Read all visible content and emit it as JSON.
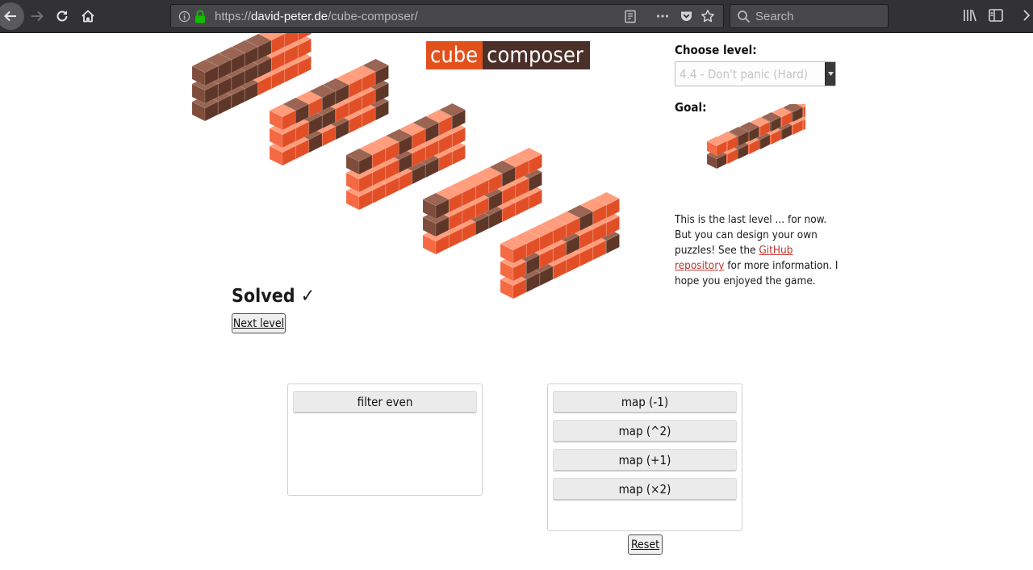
{
  "browser": {
    "url_prefix": "https://",
    "url_host": "david-peter.de",
    "url_path": "/cube-composer/",
    "search_placeholder": "Search",
    "colors": {
      "toolbar": "#323234",
      "field": "#474749",
      "secure_lock": "#12bc00"
    },
    "icons": [
      "back-arrow-icon",
      "forward-arrow-icon",
      "reload-icon",
      "home-icon",
      "info-icon",
      "lock-icon",
      "reader-view-icon",
      "more-actions-icon",
      "pocket-icon",
      "bookmark-star-icon",
      "search-icon",
      "library-icon",
      "sidebar-icon",
      "overflow-icon"
    ]
  },
  "logo": {
    "part1": "cube",
    "part2": "composer"
  },
  "colors": {
    "orange": "#e2511c",
    "brown": "#4a3029",
    "link": "#c0332e"
  },
  "status": {
    "solved_label": "Solved ✓",
    "next_level_label": "Next level"
  },
  "sidebar": {
    "choose_level_label": "Choose level:",
    "level_selected": "4.4 - Don't panic (Hard)",
    "goal_label": "Goal:",
    "info_before_link": "This is the last level ... for now. But you can design your own puzzles! See the ",
    "link_label": "GitHub repository",
    "info_after_link": " for more information. I hope you enjoyed the game."
  },
  "available_functions": [
    "filter even"
  ],
  "program_functions": [
    "map (-1)",
    "map (^2)",
    "map (+1)",
    "map (×2)"
  ],
  "reset_label": "Reset",
  "scene": {
    "walls": [
      [
        [
          "B",
          "B",
          "B"
        ],
        [
          "B",
          "B",
          "B"
        ],
        [
          "B",
          "B",
          "B"
        ],
        [
          "B",
          "B",
          "B"
        ],
        [
          "O",
          "B",
          "B"
        ],
        [
          "O",
          "O",
          "O"
        ],
        [
          "O",
          "O",
          "O"
        ],
        [
          "O",
          "O",
          "O"
        ]
      ],
      [
        [
          "O",
          "O",
          "O"
        ],
        [
          "O",
          "O",
          "B"
        ],
        [
          "B",
          "B",
          "O"
        ],
        [
          "O",
          "B",
          "B"
        ],
        [
          "B",
          "O",
          "B"
        ],
        [
          "O",
          "O",
          "O"
        ],
        [
          "O",
          "O",
          "O"
        ],
        [
          "B",
          "B",
          "B"
        ]
      ],
      [
        [
          "O",
          "O",
          "B"
        ],
        [
          "O",
          "O",
          "O"
        ],
        [
          "O",
          "O",
          "O"
        ],
        [
          "O",
          "B",
          "B"
        ],
        [
          "B",
          "O",
          "O"
        ],
        [
          "B",
          "O",
          "B"
        ],
        [
          "O",
          "O",
          "O"
        ],
        [
          "O",
          "O",
          "B"
        ]
      ],
      [
        [
          "O",
          "B",
          "B"
        ],
        [
          "O",
          "O",
          "O"
        ],
        [
          "O",
          "O",
          "O"
        ],
        [
          "B",
          "O",
          "O"
        ],
        [
          "B",
          "B",
          "O"
        ],
        [
          "O",
          "O",
          "B"
        ],
        [
          "O",
          "O",
          "O"
        ],
        [
          "O",
          "B",
          "O"
        ]
      ],
      [
        [
          "O",
          "O",
          "O"
        ],
        [
          "B",
          "B",
          "O"
        ],
        [
          "B",
          "O",
          "O"
        ],
        [
          "O",
          "O",
          "O"
        ],
        [
          "O",
          "B",
          "O"
        ],
        [
          "O",
          "O",
          "B"
        ],
        [
          "O",
          "O",
          "O"
        ],
        [
          "B",
          "O",
          "O"
        ]
      ]
    ],
    "goal": [
      [
        "B",
        "O"
      ],
      [
        "O",
        "O"
      ],
      [
        "B",
        "B"
      ],
      [
        "O",
        "B"
      ],
      [
        "B",
        "O"
      ],
      [
        "O",
        "B"
      ],
      [
        "B",
        "O"
      ],
      [
        "O",
        "B"
      ],
      [
        "O",
        "O"
      ]
    ]
  }
}
